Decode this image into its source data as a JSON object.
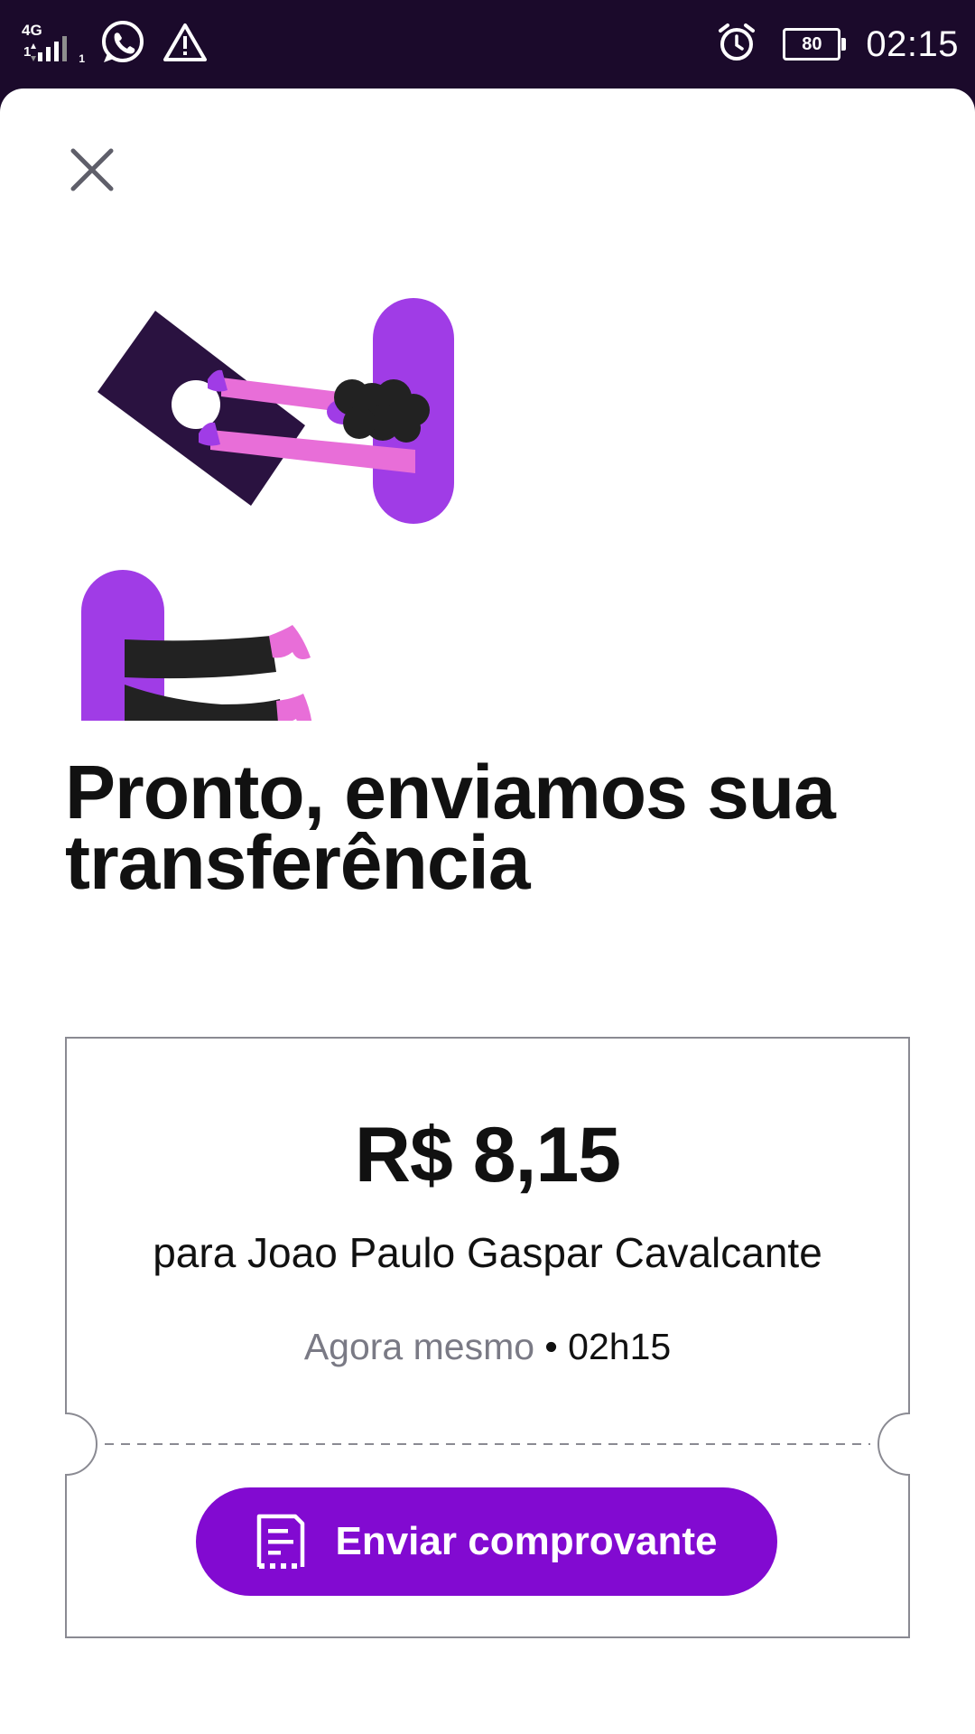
{
  "status_bar": {
    "network_type": "4G",
    "sim_slot_primary": "1",
    "sim_slot_secondary": "1",
    "battery_level": "80",
    "time": "02:15",
    "icons": [
      "signal-icon",
      "whatsapp-icon",
      "warning-icon",
      "alarm-icon",
      "battery-icon"
    ]
  },
  "sheet": {
    "close_icon": "close-icon",
    "headline": "Pronto, enviamos sua transferência"
  },
  "receipt": {
    "amount": "R$ 8,15",
    "recipient": "para Joao Paulo Gaspar Cavalcante",
    "time_relative": "Agora mesmo",
    "separator": " • ",
    "time_absolute": "02h15",
    "send_button_label": "Enviar comprovante",
    "send_button_icon": "receipt-icon"
  },
  "colors": {
    "status_bar_bg": "#1b0a2b",
    "brand_purple": "#820ad1",
    "illustration_purple": "#a03ce6",
    "illustration_pink": "#e86ed8",
    "illustration_dark": "#2a1240",
    "text_primary": "#111111",
    "text_muted": "#7a7a85"
  }
}
